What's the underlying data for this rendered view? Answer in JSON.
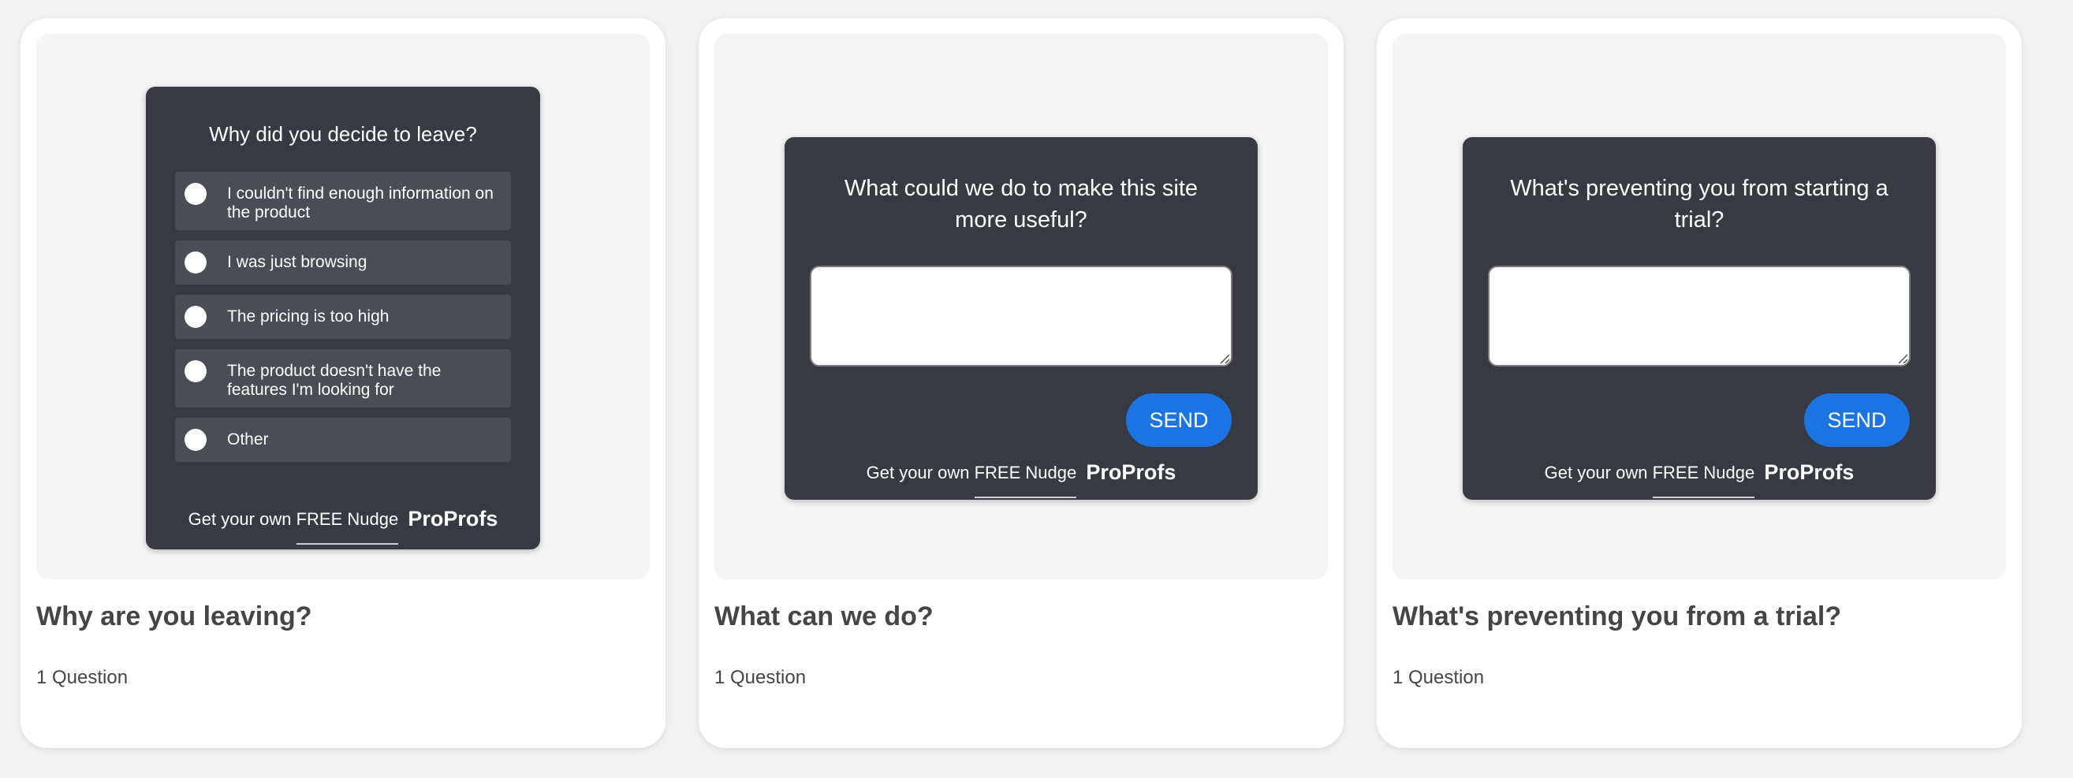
{
  "cards": [
    {
      "widget": {
        "question": "Why did you decide to leave?",
        "options": [
          "I couldn't find enough information on the product",
          "I was just browsing",
          "The pricing is too high",
          "The product doesn't have the features I'm looking for",
          "Other"
        ],
        "footer": {
          "text": "Get your own",
          "link": "FREE Nudge",
          "brand": "ProProfs"
        }
      },
      "title": "Why are you leaving?",
      "meta": "1 Question"
    },
    {
      "widget": {
        "question": "What could we do to make this site more useful?",
        "send_label": "SEND",
        "footer": {
          "text": "Get your own",
          "link": "FREE Nudge",
          "brand": "ProProfs"
        }
      },
      "title": "What can we do?",
      "meta": "1 Question"
    },
    {
      "widget": {
        "question": "What's preventing you from starting a trial?",
        "send_label": "SEND",
        "footer": {
          "text": "Get your own",
          "link": "FREE Nudge",
          "brand": "ProProfs"
        }
      },
      "title": "What's preventing you from a trial?",
      "meta": "1 Question"
    }
  ],
  "colors": {
    "page_background": "#f2f2f2",
    "card_background": "#ffffff",
    "preview_background": "#f5f5f5",
    "widget_background": "#373a41",
    "option_background": "#4a4d54",
    "send_button": "#1b74e4",
    "text_dark": "#454545"
  },
  "icons": {
    "radio": "radio-unchecked-icon",
    "resize": "resize-grip-icon"
  }
}
